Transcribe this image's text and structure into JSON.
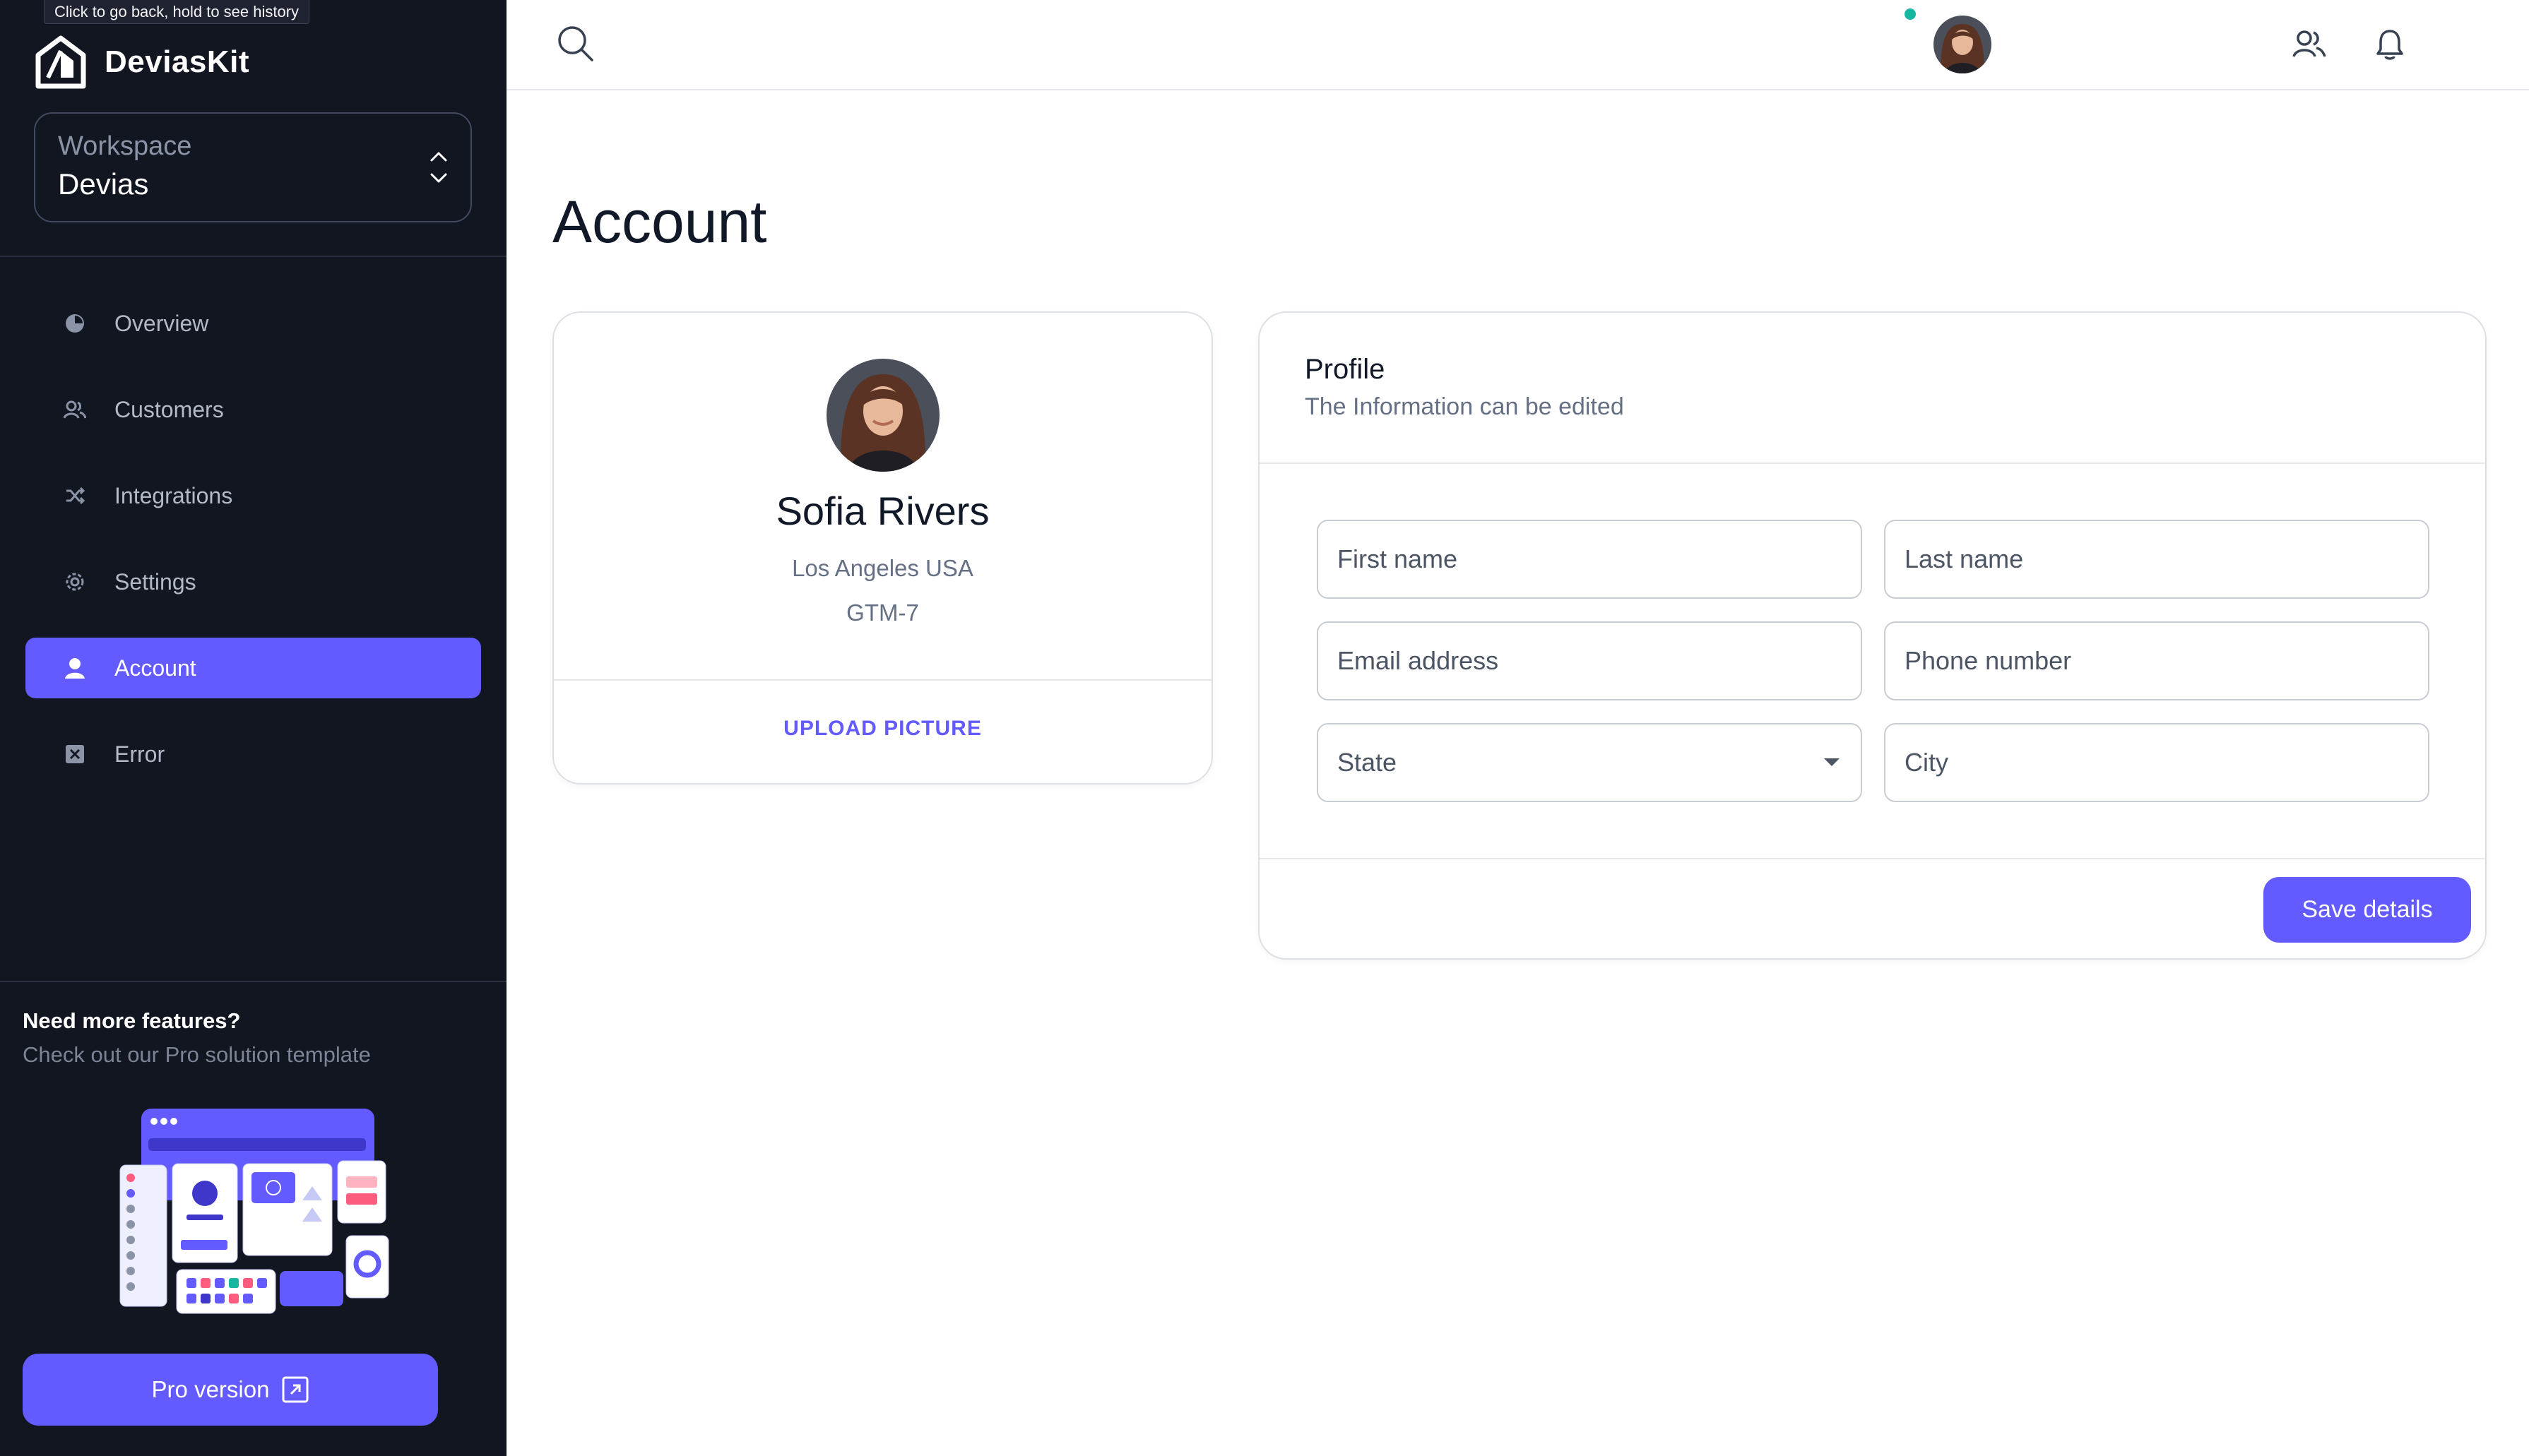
{
  "tooltip": "Click to go back, hold to see history",
  "brand": {
    "name": "DeviasKit"
  },
  "workspace": {
    "label": "Workspace",
    "value": "Devias"
  },
  "nav": {
    "items": [
      {
        "label": "Overview",
        "icon": "chart-pie-icon",
        "active": false
      },
      {
        "label": "Customers",
        "icon": "users-icon",
        "active": false
      },
      {
        "label": "Integrations",
        "icon": "plugs-icon",
        "active": false
      },
      {
        "label": "Settings",
        "icon": "gear-icon",
        "active": false
      },
      {
        "label": "Account",
        "icon": "user-icon",
        "active": true
      },
      {
        "label": "Error",
        "icon": "x-square-icon",
        "active": false
      }
    ]
  },
  "promo": {
    "title": "Need more features?",
    "subtitle": "Check out our Pro solution template",
    "button_label": "Pro version"
  },
  "topbar": {
    "icons": [
      "search-icon",
      "users-icon",
      "bell-icon",
      "avatar"
    ],
    "notification_dot": true
  },
  "page": {
    "title": "Account"
  },
  "profile_card": {
    "name": "Sofia Rivers",
    "location": "Los Angeles USA",
    "timezone": "GTM-7",
    "upload_label": "UPLOAD PICTURE"
  },
  "profile_form": {
    "title": "Profile",
    "subtitle": "The Information can be edited",
    "fields": {
      "first_name": "First name",
      "last_name": "Last name",
      "email": "Email address",
      "phone": "Phone number",
      "state": "State",
      "city": "City"
    },
    "save_label": "Save details"
  },
  "colors": {
    "sidebar_bg": "#121621",
    "accent": "#635bff",
    "notification": "#15b79e"
  }
}
